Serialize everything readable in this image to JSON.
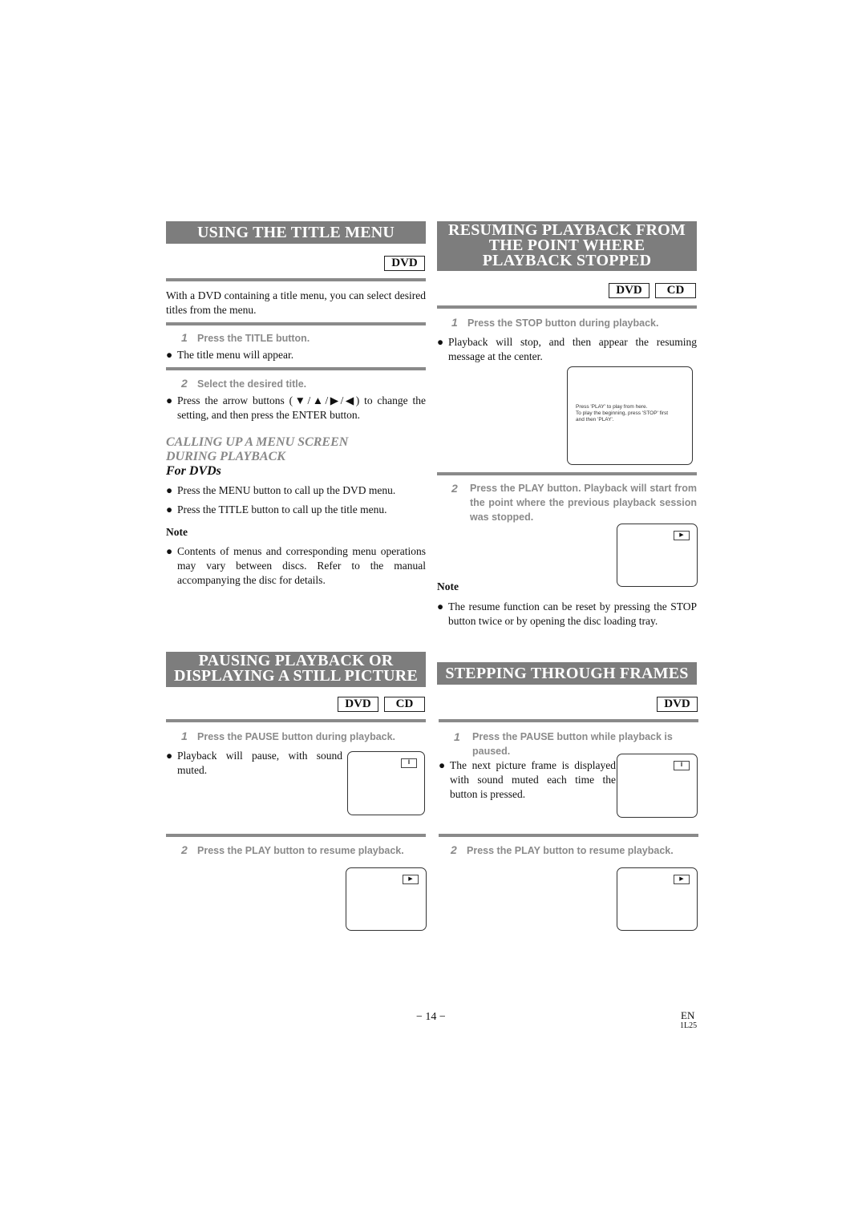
{
  "left": {
    "title_menu": {
      "heading": "USING THE TITLE MENU",
      "badges": [
        "DVD"
      ],
      "intro": "With a DVD containing a title menu, you can select desired titles from the menu.",
      "steps": [
        {
          "num": "1",
          "text": "Press the TITLE button.",
          "bullet": "The title menu will appear."
        },
        {
          "num": "2",
          "text": "Select the desired title.",
          "bullet": "Press the arrow buttons (▼/▲/▶/◀) to change the setting, and then press the ENTER button."
        }
      ],
      "subheading_line1": "CALLING UP A MENU SCREEN",
      "subheading_line2": "DURING PLAYBACK",
      "for_label": "For DVDs",
      "bullets": [
        "Press the MENU button to call up the DVD menu.",
        "Press the TITLE button to call up the title menu."
      ],
      "note_label": "Note",
      "note": "Contents of menus and corresponding menu operations may vary between discs. Refer to the manual accompanying the disc for details."
    },
    "pausing": {
      "heading_line1": "PAUSING PLAYBACK OR",
      "heading_line2": "DISPLAYING A STILL PICTURE",
      "badges": [
        "DVD",
        "CD"
      ],
      "steps": [
        {
          "num": "1",
          "text": "Press the PAUSE button during playback.",
          "bullet": "Playback will pause, with sound muted.",
          "screen_icon": "‖"
        },
        {
          "num": "2",
          "text": "Press the PLAY button to resume playback.",
          "screen_icon": "▶"
        }
      ]
    }
  },
  "right": {
    "resuming": {
      "heading_line1": "RESUMING PLAYBACK FROM",
      "heading_line2": "THE POINT WHERE",
      "heading_line3": "PLAYBACK STOPPED",
      "badges": [
        "DVD",
        "CD"
      ],
      "steps": [
        {
          "num": "1",
          "text": "Press the STOP button during playback.",
          "bullet": "Playback will stop, and then appear the resuming message at the center."
        },
        {
          "num": "2",
          "text": "Press the PLAY button. Playback will start from the point where the previous playback session was stopped.",
          "screen_icon": "▶"
        }
      ],
      "screen_message": [
        "Press 'PLAY' to play from here.",
        "To play the beginning, press 'STOP' first",
        "and then 'PLAY'."
      ],
      "note_label": "Note",
      "note": "The resume function can be reset by pressing the STOP button twice or by opening the disc loading tray."
    },
    "stepping": {
      "heading": "STEPPING THROUGH FRAMES",
      "badges": [
        "DVD"
      ],
      "steps": [
        {
          "num": "1",
          "text_line1": "Press the PAUSE button while playback is",
          "text_line2": "paused.",
          "bullet": "The next picture frame is displayed with sound muted each time the button is pressed.",
          "screen_icon": "‖"
        },
        {
          "num": "2",
          "text": "Press the PLAY button to resume playback.",
          "screen_icon": "▶"
        }
      ]
    }
  },
  "footer": {
    "page": "− 14 −",
    "lang": "EN",
    "code": "1L25"
  },
  "bullet_glyph": "●"
}
